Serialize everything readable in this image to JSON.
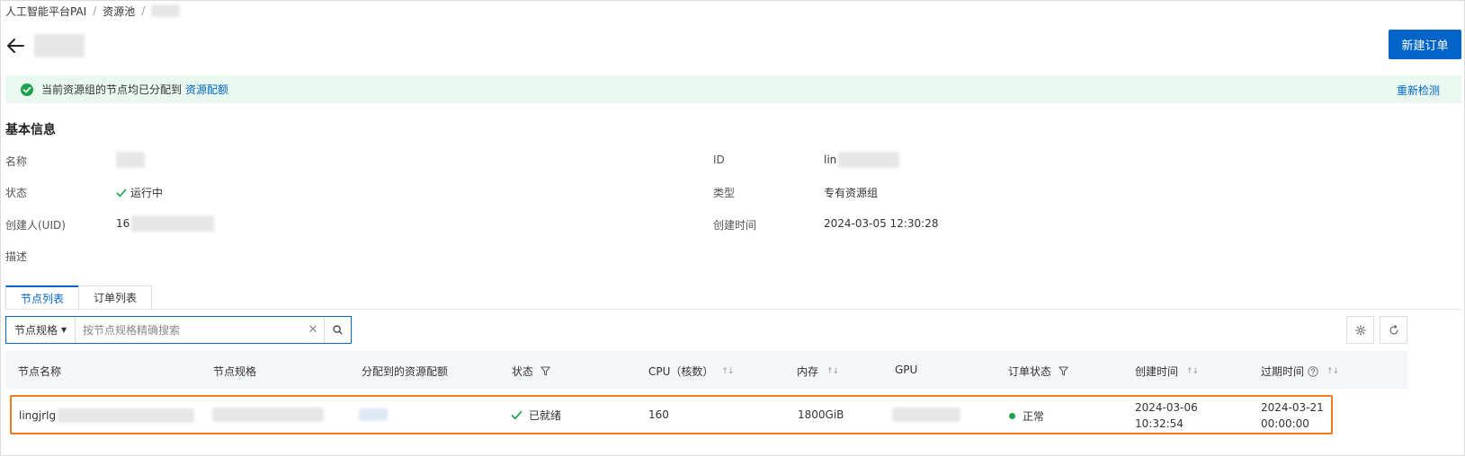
{
  "breadcrumb": {
    "root": "人工智能平台PAI",
    "pool": "资源池",
    "sep": "/"
  },
  "header": {
    "new_order_label": "新建订单"
  },
  "banner": {
    "message": "当前资源组的节点均已分配到",
    "link": "资源配额",
    "recheck": "重新检测",
    "color": "#e9f9ef"
  },
  "basic_info": {
    "title": "基本信息",
    "name_label": "名称",
    "status_label": "状态",
    "status_value": "运行中",
    "creator_label": "创建人(UID)",
    "creator_value_prefix": "16",
    "desc_label": "描述",
    "id_label": "ID",
    "id_value_prefix": "lin",
    "type_label": "类型",
    "type_value": "专有资源组",
    "created_label": "创建时间",
    "created_value": "2024-03-05 12:30:28"
  },
  "tabs": [
    {
      "label": "节点列表",
      "active": true
    },
    {
      "label": "订单列表",
      "active": false
    }
  ],
  "search": {
    "field": "节点规格",
    "placeholder": "按节点规格精确搜索"
  },
  "table": {
    "columns": {
      "name": "节点名称",
      "spec": "节点规格",
      "quota": "分配到的资源配额",
      "status": "状态",
      "cpu": "CPU（核数）",
      "memory": "内存",
      "gpu": "GPU",
      "order_status": "订单状态",
      "created": "创建时间",
      "expire": "过期时间"
    },
    "rows": [
      {
        "name_prefix": "lingjrlg",
        "status": "已就绪",
        "cpu": "160",
        "memory": "1800GiB",
        "order_status": "正常",
        "created_date": "2024-03-06",
        "created_time": "10:32:54",
        "expire_date": "2024-03-21",
        "expire_time": "00:00:00"
      }
    ]
  },
  "colors": {
    "primary": "#0064c8",
    "success": "#1aa34a",
    "highlight": "#f07a1e"
  }
}
